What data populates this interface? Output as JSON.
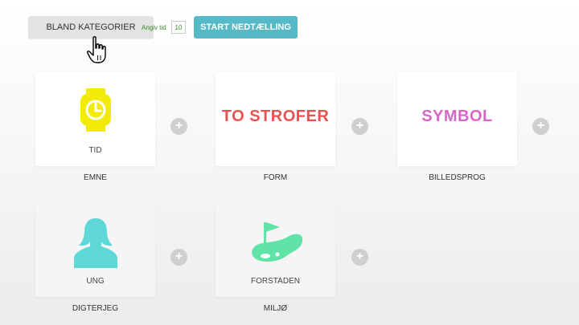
{
  "toolbar": {
    "shuffle_label": "BLAND KATEGORIER",
    "time_label": "Angiv tid",
    "time_value": "10",
    "start_label": "START NEDTÆLLING"
  },
  "colors": {
    "accent": "#55b9c6",
    "time_text": "#3a8a2a",
    "watch": "#f2ea07",
    "to_strofer": "#e6524f",
    "symbol": "#d866c8",
    "person": "#5ed8d6",
    "golf": "#5fe3a6",
    "plus": "#cfcfcf"
  },
  "cards": [
    {
      "icon": "watch-icon",
      "value": "TID",
      "category": "EMNE"
    },
    {
      "icon": "",
      "value": "TO STROFER",
      "category": "FORM"
    },
    {
      "icon": "",
      "value": "SYMBOL",
      "category": "BILLEDSPROG"
    },
    {
      "icon": "person-icon",
      "value": "UNG",
      "category": "DIGTERJEG"
    },
    {
      "icon": "golf-flag-icon",
      "value": "FORSTADEN",
      "category": "MILJØ"
    }
  ]
}
